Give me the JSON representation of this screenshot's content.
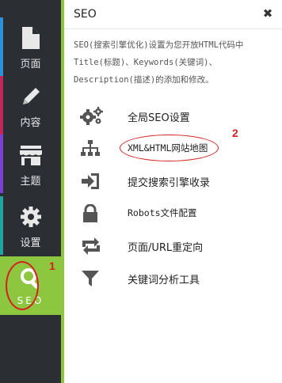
{
  "sidebar": {
    "items": [
      {
        "label": "页面",
        "icon": "page-icon",
        "color": "#2d8fd8"
      },
      {
        "label": "内容",
        "icon": "pencil-icon",
        "color": "#c0265a"
      },
      {
        "label": "主题",
        "icon": "store-icon",
        "color": "#7b3fd1"
      },
      {
        "label": "设置",
        "icon": "gear-icon",
        "color": "#1fa3a3"
      },
      {
        "label": "SEO",
        "icon": "search-icon",
        "color": "#8dc63f"
      }
    ]
  },
  "panel": {
    "title": "SEO",
    "description": "SEO(搜索引擎优化)设置为您开放HTML代码中Title(标题)、Keywords(关键词)、Description(描述)的添加和修改。",
    "menu": [
      {
        "label": "全局SEO设置",
        "icon": "gears-icon"
      },
      {
        "label": "XML&HTML网站地图",
        "icon": "sitemap-icon"
      },
      {
        "label": "提交搜索引擎收录",
        "icon": "submit-icon"
      },
      {
        "label": "Robots文件配置",
        "icon": "lock-icon"
      },
      {
        "label": "页面/URL重定向",
        "icon": "redirect-icon"
      },
      {
        "label": "关键词分析工具",
        "icon": "filter-icon"
      }
    ]
  },
  "annotations": {
    "one": "1",
    "two": "2"
  }
}
